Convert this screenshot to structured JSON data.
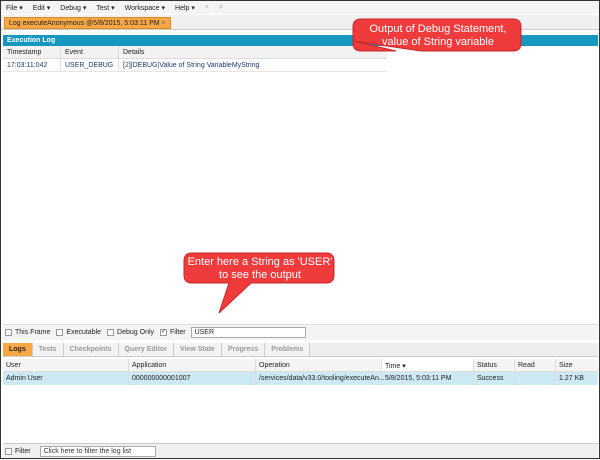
{
  "menu": [
    "File ▾",
    "Edit ▾",
    "Debug ▾",
    "Test ▾",
    "Workspace ▾",
    "Help ▾",
    "<",
    ">"
  ],
  "log_tab": {
    "label": "Log executeAnonymous @5/8/2015, 5:03:11 PM",
    "close": "×"
  },
  "execution_log": {
    "title": "Execution Log",
    "columns": [
      "Timestamp",
      "Event",
      "Details"
    ],
    "rows": [
      [
        "17:03:11:042",
        "USER_DEBUG",
        "[2]|DEBUG|Value of String VariableMyString"
      ]
    ]
  },
  "filters": {
    "this_frame": "This Frame",
    "executable": "Executable",
    "debug_only": "Debug Only",
    "filter": "Filter",
    "filter_checked": true,
    "filter_value": "USER"
  },
  "bottom_tabs": [
    "Logs",
    "Tests",
    "Checkpoints",
    "Query Editor",
    "View State",
    "Progress",
    "Problems"
  ],
  "active_tab": "Logs",
  "logs_grid": {
    "columns": [
      "User",
      "Application",
      "Operation",
      "Time ▾",
      "Status",
      "Read",
      "Size"
    ],
    "rows": [
      [
        "Admin User",
        "000000000001007",
        "/services/data/v33.0/tooling/executeAn...",
        "5/8/2015, 5:03:11 PM",
        "Success",
        "",
        "1.27 KB"
      ]
    ]
  },
  "bottom_filter": {
    "label": "Filter",
    "placeholder": "Click here to filter the log list"
  },
  "callouts": {
    "debug": "Output of Debug Statement, value of String variable",
    "filter": "Enter here a String as 'USER' to see the output"
  },
  "colors": {
    "accent_orange": "#f8a845",
    "header_blue": "#1797c0",
    "callout_red": "#ef3b3b",
    "selected_row": "#cdeaf4"
  }
}
